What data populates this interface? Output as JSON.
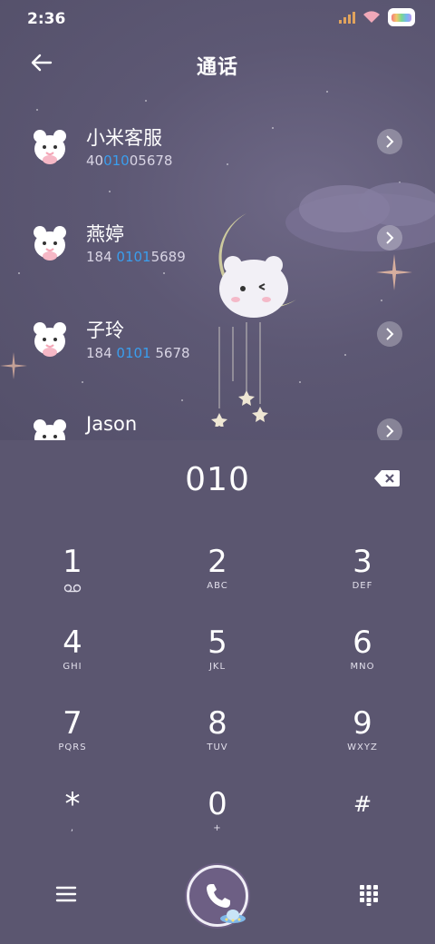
{
  "status_bar": {
    "time": "2:36"
  },
  "header": {
    "title": "通话"
  },
  "contacts": [
    {
      "name": "小米客服",
      "num_pre": "40",
      "num_hl": "010",
      "num_post": "05678"
    },
    {
      "name": "燕婷",
      "num_pre": "184 ",
      "num_hl": "0101",
      "num_post": "5689"
    },
    {
      "name": "子玲",
      "num_pre": "184 ",
      "num_hl": "0101",
      "num_post": " 5678"
    },
    {
      "name": "Jason",
      "num_pre": "",
      "num_hl": "",
      "num_post": ""
    }
  ],
  "dialer": {
    "entered": "010"
  },
  "keypad": [
    {
      "num": "1",
      "sub": ""
    },
    {
      "num": "2",
      "sub": "ABC"
    },
    {
      "num": "3",
      "sub": "DEF"
    },
    {
      "num": "4",
      "sub": "GHI"
    },
    {
      "num": "5",
      "sub": "JKL"
    },
    {
      "num": "6",
      "sub": "MNO"
    },
    {
      "num": "7",
      "sub": "PQRS"
    },
    {
      "num": "8",
      "sub": "TUV"
    },
    {
      "num": "9",
      "sub": "WXYZ"
    },
    {
      "num": "*",
      "sub": ","
    },
    {
      "num": "0",
      "sub": "+"
    },
    {
      "num": "#",
      "sub": ""
    }
  ],
  "colors": {
    "background": "#5b5670",
    "highlight": "#3a9eee",
    "call_button": "#6d5f84"
  },
  "icons": [
    "back-arrow-icon",
    "chevron-right-icon",
    "backspace-icon",
    "voicemail-icon",
    "menu-icon",
    "phone-icon",
    "keypad-icon"
  ]
}
